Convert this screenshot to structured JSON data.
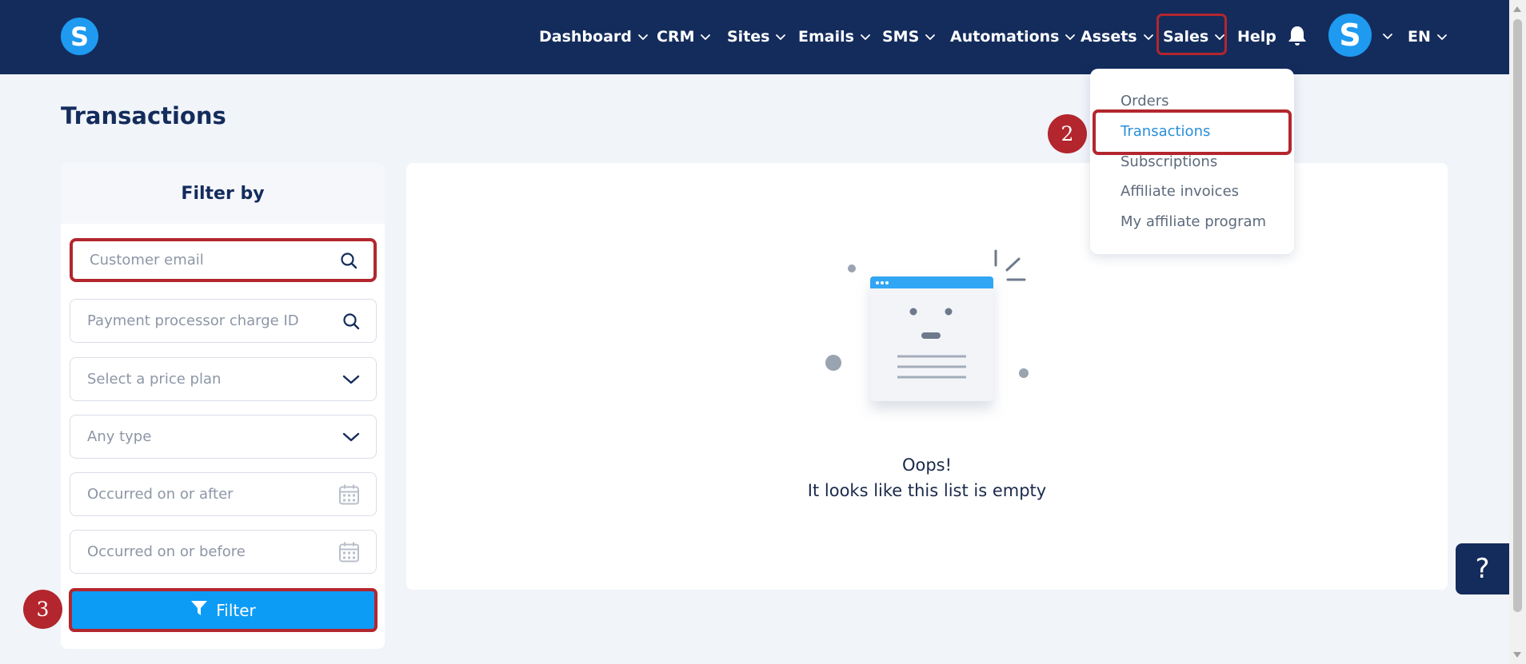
{
  "brand": {
    "logo_letter": "S"
  },
  "nav": {
    "items": [
      {
        "label": "Dashboard",
        "has_dropdown": true
      },
      {
        "label": "CRM",
        "has_dropdown": true
      },
      {
        "label": "Sites",
        "has_dropdown": true
      },
      {
        "label": "Emails",
        "has_dropdown": true
      },
      {
        "label": "SMS",
        "has_dropdown": true
      },
      {
        "label": "Automations",
        "has_dropdown": true
      },
      {
        "label": "Assets",
        "has_dropdown": true
      },
      {
        "label": "Sales",
        "has_dropdown": true
      },
      {
        "label": "Help",
        "has_dropdown": false
      }
    ],
    "bell_icon": "bell-icon",
    "avatar_letter": "S",
    "language": "EN"
  },
  "page": {
    "title": "Transactions"
  },
  "filter": {
    "header": "Filter by",
    "customer_email_placeholder": "Customer email",
    "charge_id_placeholder": "Payment processor charge ID",
    "price_plan_placeholder": "Select a price plan",
    "type_placeholder": "Any type",
    "after_placeholder": "Occurred on or after",
    "before_placeholder": "Occurred on or before",
    "button_label": "Filter"
  },
  "empty_state": {
    "title": "Oops!",
    "message": "It looks like this list is empty"
  },
  "sales_menu": {
    "items": [
      "Orders",
      "Transactions",
      "Subscriptions",
      "Affiliate invoices",
      "My affiliate program"
    ],
    "active": "Transactions"
  },
  "annotations": {
    "step2": "2",
    "step3": "3"
  },
  "help_button": "?",
  "colors": {
    "nav_bg": "#142c5c",
    "accent_blue": "#1e9af0",
    "filter_button": "#0d9cf5",
    "highlight_red": "#b3262e",
    "page_bg": "#f1f4f9"
  }
}
